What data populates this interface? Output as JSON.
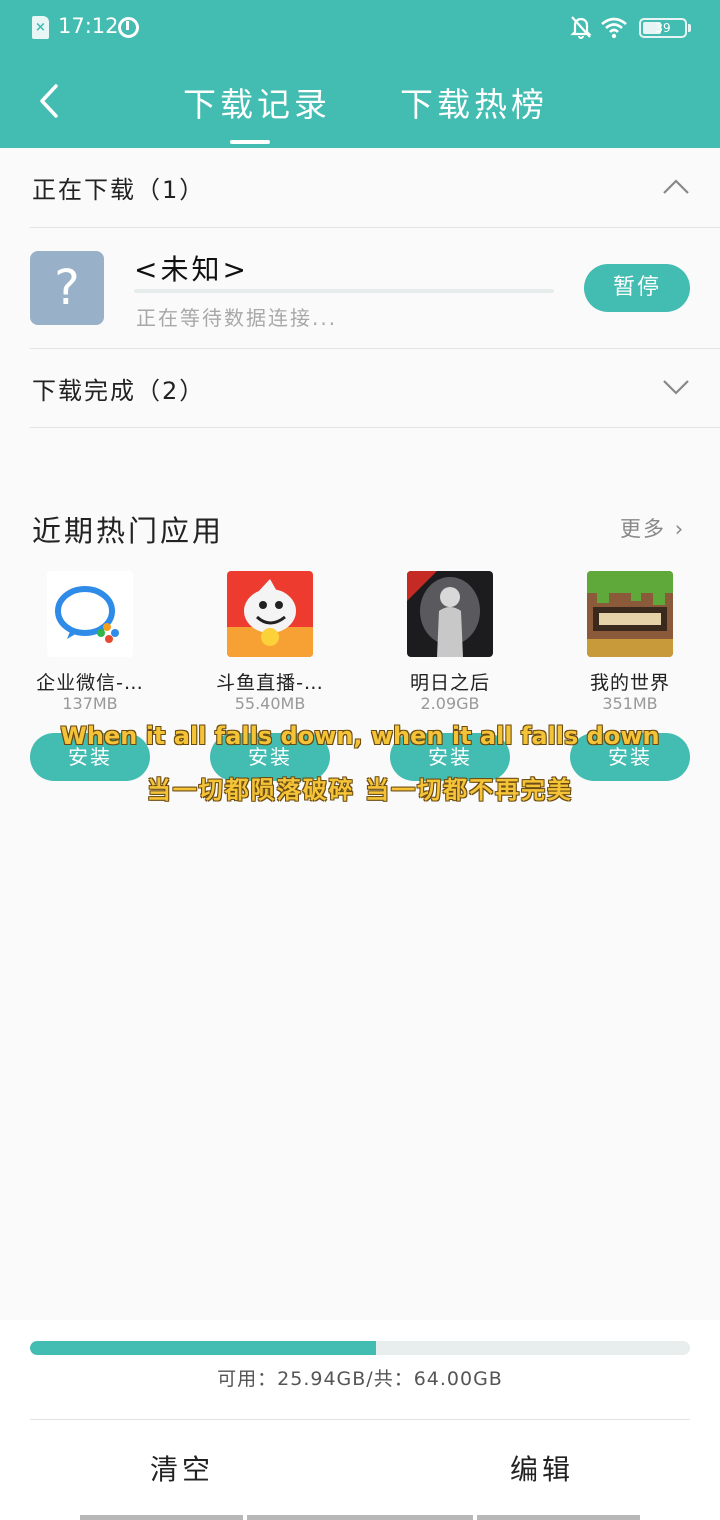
{
  "status_bar": {
    "time": "17:12",
    "battery_level": "39",
    "icons": [
      "sim-icon",
      "sync-icon",
      "bell-off-icon",
      "wifi-icon",
      "battery-icon"
    ]
  },
  "header": {
    "tabs": [
      {
        "label": "下载记录",
        "active": true
      },
      {
        "label": "下载热榜",
        "active": false
      }
    ],
    "background_color": "#43bcb1"
  },
  "downloading": {
    "title": "正在下载（1）",
    "items": [
      {
        "icon_symbol": "?",
        "name": "<未知>",
        "status": "正在等待数据连接...",
        "action_label": "暂停"
      }
    ]
  },
  "completed": {
    "title": "下载完成（2）"
  },
  "hot_apps": {
    "title": "近期热门应用",
    "more_label": "更多",
    "apps": [
      {
        "name": "企业微信-…",
        "size": "137MB",
        "install_label": "安装"
      },
      {
        "name": "斗鱼直播-…",
        "size": "55.40MB",
        "install_label": "安装"
      },
      {
        "name": "明日之后",
        "size": "2.09GB",
        "install_label": "安装"
      },
      {
        "name": "我的世界",
        "size": "351MB",
        "install_label": "安装"
      }
    ]
  },
  "overlay_subtitles": {
    "en": "When it all falls down, when it all falls down",
    "zh": "当一切都陨落破碎 当一切都不再完美"
  },
  "storage": {
    "text": "可用：25.94GB/共：64.00GB",
    "used_fraction": 0.5247
  },
  "footer": {
    "clear_label": "清空",
    "edit_label": "编辑"
  },
  "accent_color": "#43bcb1"
}
